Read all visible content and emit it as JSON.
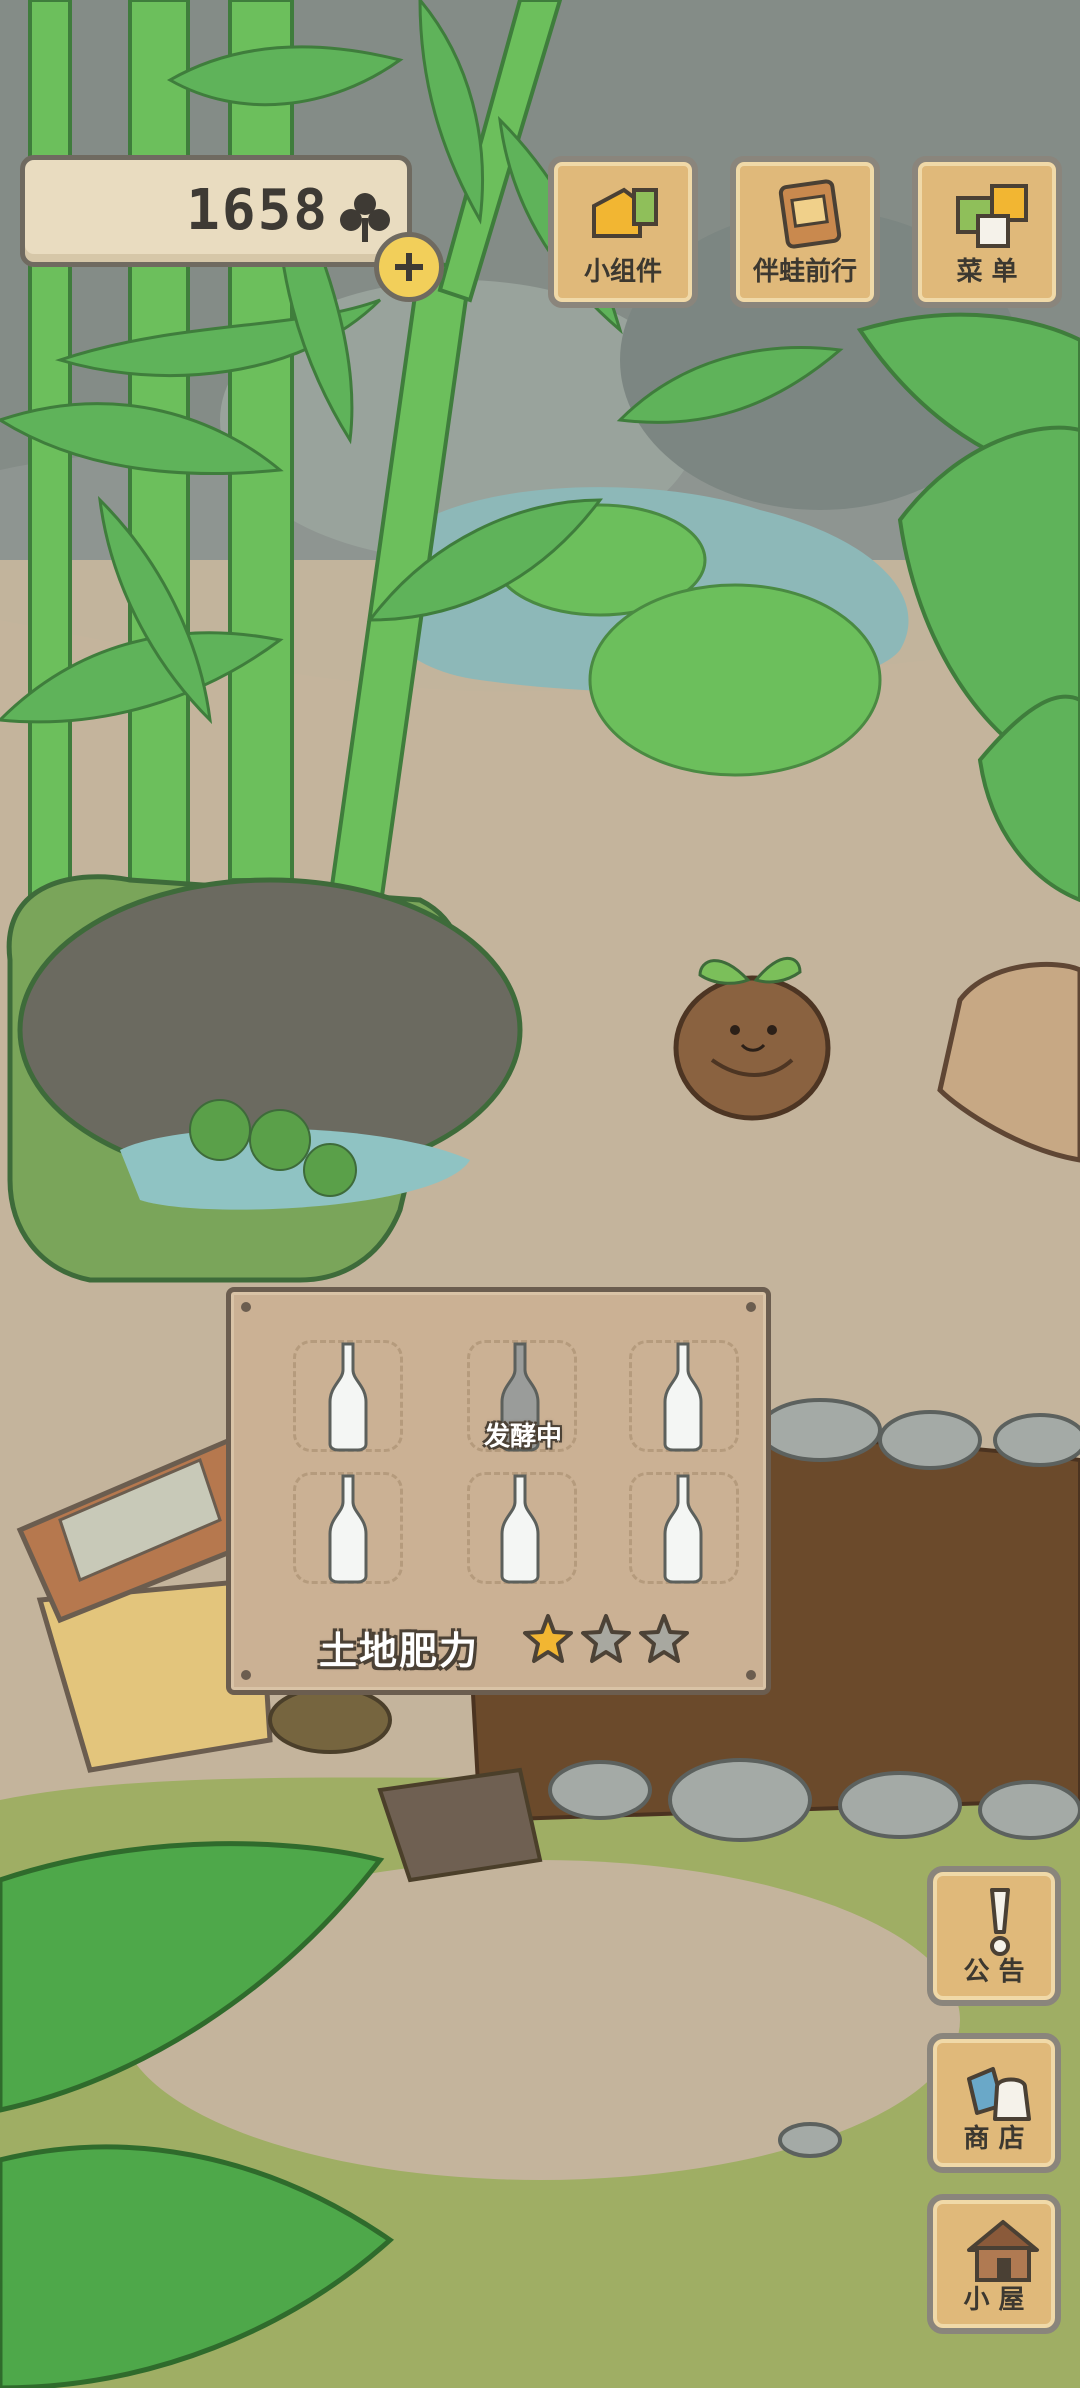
{
  "currency": {
    "clovers": "1658",
    "icon": "clover-icon",
    "add_icon": "plus-icon"
  },
  "top_buttons": [
    {
      "label": "小组件",
      "icon": "widget-icon"
    },
    {
      "label": "伴蛙前行",
      "icon": "travel-album-icon"
    },
    {
      "label": "菜 单",
      "icon": "menu-icon"
    }
  ],
  "garden_panel": {
    "fermenting_label": "发酵中",
    "fertility_label": "土地肥力",
    "fertility_stars": {
      "filled": 1,
      "total": 3
    },
    "bottles": [
      {
        "state": "empty"
      },
      {
        "state": "fermenting"
      },
      {
        "state": "empty"
      },
      {
        "state": "empty"
      },
      {
        "state": "empty"
      },
      {
        "state": "empty"
      }
    ]
  },
  "side_buttons": [
    {
      "label": "公 告",
      "icon": "exclamation-icon"
    },
    {
      "label": "商 店",
      "icon": "shop-bag-icon"
    },
    {
      "label": "小 屋",
      "icon": "house-icon"
    }
  ],
  "colors": {
    "star_filled": "#f2b632",
    "star_empty": "#a8a8a0",
    "bamboo": "#5fb35a",
    "soil": "#6b4a2b",
    "wood": "#e0b97a"
  }
}
